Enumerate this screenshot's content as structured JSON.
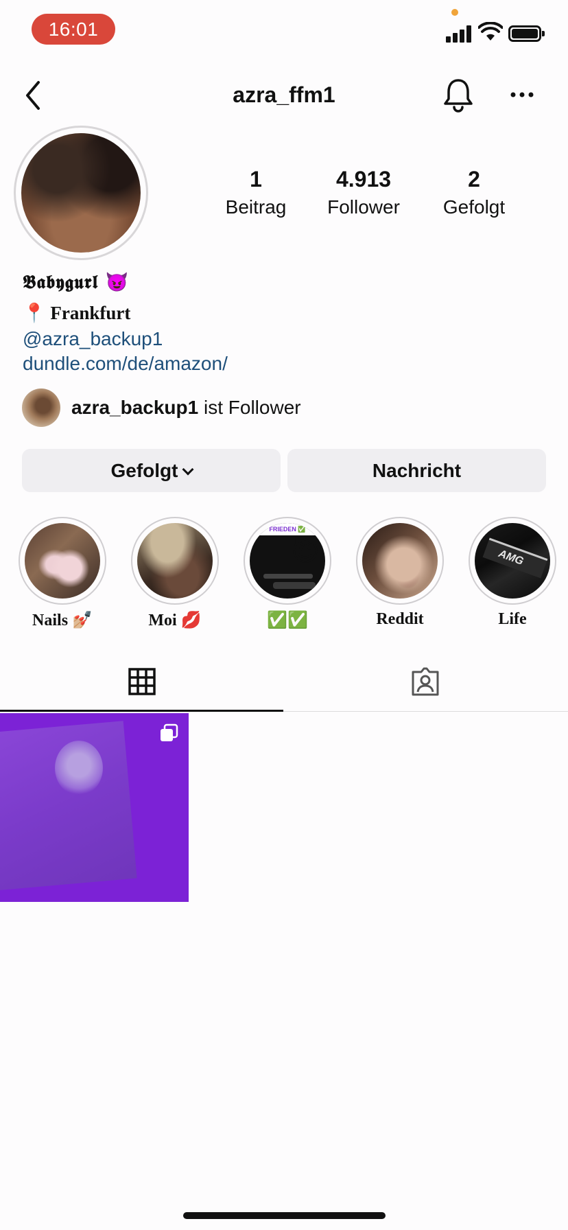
{
  "status_bar": {
    "time": "16:01"
  },
  "header": {
    "username": "azra_ffm1"
  },
  "stats": [
    {
      "value": "1",
      "label": "Beitrag"
    },
    {
      "value": "4.913",
      "label": "Follower"
    },
    {
      "value": "2",
      "label": "Gefolgt"
    }
  ],
  "bio": {
    "name": "𝕭𝖆𝖇𝖞𝖌𝖚𝖗𝖑 😈",
    "location": "📍 Frankfurt",
    "mention": "@azra_backup1",
    "link": "dundle.com/de/amazon/"
  },
  "followed_by": {
    "username": "azra_backup1",
    "suffix": " ist Follower"
  },
  "actions": {
    "following_label": "Gefolgt",
    "message_label": "Nachricht"
  },
  "highlights": [
    {
      "label": "Nails 💅🏼"
    },
    {
      "label": "Moi 💋"
    },
    {
      "label": "✅✅",
      "badge": "😈",
      "strip_text": "FRIEDEN ✅"
    },
    {
      "label": "Reddit"
    },
    {
      "label": "Life",
      "badge_text": "AMG"
    }
  ],
  "tabs": {
    "grid": "grid-icon",
    "tagged": "tagged-icon"
  },
  "colors": {
    "time_pill": "#d9473a",
    "link": "#1e4f7a",
    "post_bg": "#7c22d6"
  }
}
